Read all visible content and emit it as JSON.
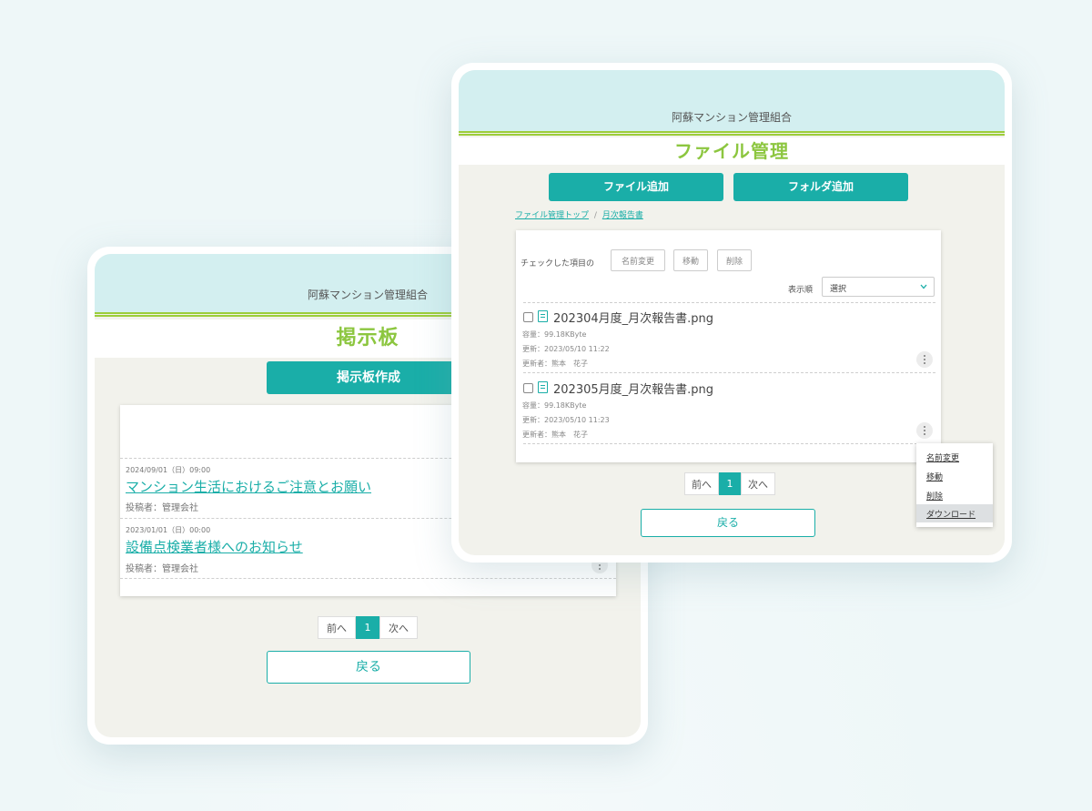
{
  "bulletin_screen": {
    "org_name": "阿蘇マンション管理組合",
    "page_title": "掲示板",
    "create_button": "掲示板作成",
    "posts": [
      {
        "date": "2024/09/01（日）09:00",
        "title": "マンション生活におけるご注意とお願い",
        "author": "投稿者：管理会社"
      },
      {
        "date": "2023/01/01（日）00:00",
        "title": "設備点検業者様へのお知らせ",
        "author": "投稿者：管理会社"
      }
    ],
    "pager": {
      "prev": "前へ",
      "current": "1",
      "next": "次へ"
    },
    "back_button": "戻る"
  },
  "file_screen": {
    "org_name": "阿蘇マンション管理組合",
    "page_title": "ファイル管理",
    "add_file_button": "ファイル追加",
    "add_folder_button": "フォルダ追加",
    "breadcrumb": {
      "root": "ファイル管理トップ",
      "separator": "/",
      "current": "月次報告書"
    },
    "bulk": {
      "label": "チェックした項目の",
      "rename": "名前変更",
      "move": "移動",
      "delete": "削除"
    },
    "sort": {
      "label": "表示順",
      "value": "選択"
    },
    "files": [
      {
        "name": "202304月度_月次報告書.png",
        "size": "容量：99.18KByte",
        "updated": "更新：2023/05/10 11:22",
        "updater": "更新者：熊本　花子"
      },
      {
        "name": "202305月度_月次報告書.png",
        "size": "容量：99.18KByte",
        "updated": "更新：2023/05/10 11:23",
        "updater": "更新者：熊本　花子"
      }
    ],
    "context_menu": {
      "rename": "名前変更",
      "move": "移動",
      "delete": "削除",
      "download": "ダウンロード"
    },
    "pager": {
      "prev": "前へ",
      "current": "1",
      "next": "次へ"
    },
    "back_button": "戻る"
  },
  "colors": {
    "accent": "#1aaea8",
    "title_green": "#8cc63f",
    "header_band": "#d3eff0",
    "screen_bg": "#f2f2ec"
  },
  "icons": [
    "file-icon",
    "kebab-menu-icon",
    "chevron-down-icon",
    "checkbox-icon"
  ]
}
